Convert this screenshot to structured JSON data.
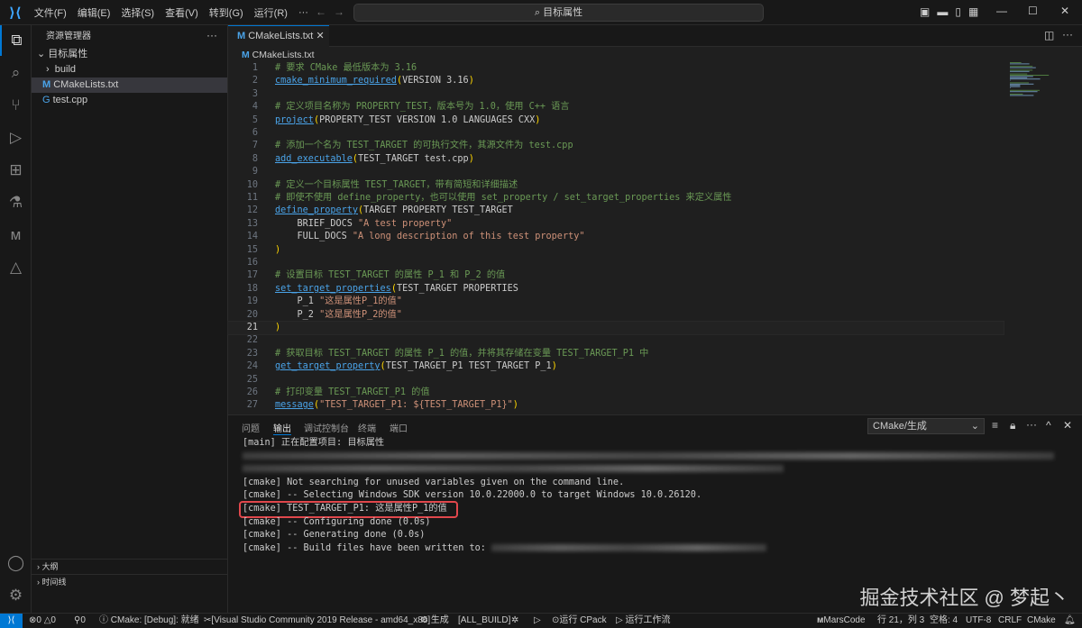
{
  "titlebar": {
    "menus": [
      "文件(F)",
      "编辑(E)",
      "选择(S)",
      "查看(V)",
      "转到(G)",
      "运行(R)",
      "···"
    ],
    "search": "目标属性"
  },
  "sidebar": {
    "title": "资源管理器",
    "more": "···",
    "folder": "目标属性",
    "items": [
      {
        "label": "build",
        "type": "folder"
      },
      {
        "label": "CMakeLists.txt",
        "type": "cmake",
        "selected": true
      },
      {
        "label": "test.cpp",
        "type": "cpp"
      }
    ],
    "outline": "大纲",
    "timeline": "时间线"
  },
  "editor": {
    "tab": "CMakeLists.txt",
    "breadcrumb": "CMakeLists.txt",
    "current_line": 21,
    "lines": [
      [
        [
          "c-com",
          "# 要求 CMake 最低版本为 3.16"
        ]
      ],
      [
        [
          "c-fn",
          "cmake_minimum_required"
        ],
        [
          "c-par",
          "("
        ],
        [
          "c-txt",
          "VERSION 3.16"
        ],
        [
          "c-par",
          ")"
        ]
      ],
      [],
      [
        [
          "c-com",
          "# 定义项目名称为 PROPERTY_TEST，版本号为 1.0，使用 C++ 语言"
        ]
      ],
      [
        [
          "c-fn",
          "project"
        ],
        [
          "c-par",
          "("
        ],
        [
          "c-txt",
          "PROPERTY_TEST VERSION 1.0 LANGUAGES CXX"
        ],
        [
          "c-par",
          ")"
        ]
      ],
      [],
      [
        [
          "c-com",
          "# 添加一个名为 TEST_TARGET 的可执行文件，其源文件为 test.cpp"
        ]
      ],
      [
        [
          "c-fn",
          "add_executable"
        ],
        [
          "c-par",
          "("
        ],
        [
          "c-txt",
          "TEST_TARGET test.cpp"
        ],
        [
          "c-par",
          ")"
        ]
      ],
      [],
      [
        [
          "c-com",
          "# 定义一个目标属性 TEST_TARGET，带有简短和详细描述"
        ]
      ],
      [
        [
          "c-com",
          "# 即使不使用 define_property，也可以使用 set_property / set_target_properties 来定义属性"
        ]
      ],
      [
        [
          "c-fn",
          "define_property"
        ],
        [
          "c-par",
          "("
        ],
        [
          "c-txt",
          "TARGET PROPERTY TEST_TARGET"
        ]
      ],
      [
        [
          "c-txt",
          "    BRIEF_DOCS "
        ],
        [
          "c-str",
          "\"A test property\""
        ]
      ],
      [
        [
          "c-txt",
          "    FULL_DOCS "
        ],
        [
          "c-str",
          "\"A long description of this test property\""
        ]
      ],
      [
        [
          "c-par",
          ")"
        ]
      ],
      [],
      [
        [
          "c-com",
          "# 设置目标 TEST_TARGET 的属性 P_1 和 P_2 的值"
        ]
      ],
      [
        [
          "c-fn",
          "set_target_properties"
        ],
        [
          "c-par",
          "("
        ],
        [
          "c-txt",
          "TEST_TARGET PROPERTIES"
        ]
      ],
      [
        [
          "c-txt",
          "    P_1 "
        ],
        [
          "c-str",
          "\"这是属性P_1的值\""
        ]
      ],
      [
        [
          "c-txt",
          "    P_2 "
        ],
        [
          "c-str",
          "\"这是属性P_2的值\""
        ]
      ],
      [
        [
          "c-par",
          ")"
        ]
      ],
      [],
      [
        [
          "c-com",
          "# 获取目标 TEST_TARGET 的属性 P_1 的值，并将其存储在变量 TEST_TARGET_P1 中"
        ]
      ],
      [
        [
          "c-fn",
          "get_target_property"
        ],
        [
          "c-par",
          "("
        ],
        [
          "c-txt",
          "TEST_TARGET_P1 TEST_TARGET P_1"
        ],
        [
          "c-par",
          ")"
        ]
      ],
      [],
      [
        [
          "c-com",
          "# 打印变量 TEST_TARGET_P1 的值"
        ]
      ],
      [
        [
          "c-fn",
          "message"
        ],
        [
          "c-par",
          "("
        ],
        [
          "c-str",
          "\"TEST_TARGET_P1: ${TEST_TARGET_P1}\""
        ],
        [
          "c-par",
          ")"
        ]
      ]
    ]
  },
  "panel": {
    "tabs": [
      "问题",
      "输出",
      "调试控制台",
      "终端",
      "端口"
    ],
    "active_tab": "输出",
    "channel": "CMake/生成",
    "output": [
      "[main] 正在配置项目: 目标属性",
      "",
      "",
      "[cmake] Not searching for unused variables given on the command line.",
      "[cmake] -- Selecting Windows SDK version 10.0.22000.0 to target Windows 10.0.26120.",
      "[cmake] TEST_TARGET_P1: 这是属性P_1的值",
      "[cmake] -- Configuring done (0.0s)",
      "[cmake] -- Generating done (0.0s)",
      "[cmake] -- Build files have been written to:"
    ],
    "highlight_color": "#e0474c"
  },
  "statusbar": {
    "errors": "0",
    "warnings": "0",
    "ports": "0",
    "cmake_status": "CMake: [Debug]: 就绪",
    "kit": "[Visual Studio Community 2019 Release - amd64_x86]",
    "build": "生成",
    "target": "[ALL_BUILD]",
    "run_cpack": "运行 CPack",
    "run_workflow": "运行工作流",
    "marscode": "MarsCode",
    "position": "行 21，列 3",
    "spaces": "空格: 4",
    "encoding": "UTF-8",
    "eol": "CRLF",
    "language": "CMake"
  },
  "watermark": "掘金技术社区 @ 梦起丶",
  "colors": {
    "accent": "#0078d4",
    "background": "#1f1f1f"
  }
}
